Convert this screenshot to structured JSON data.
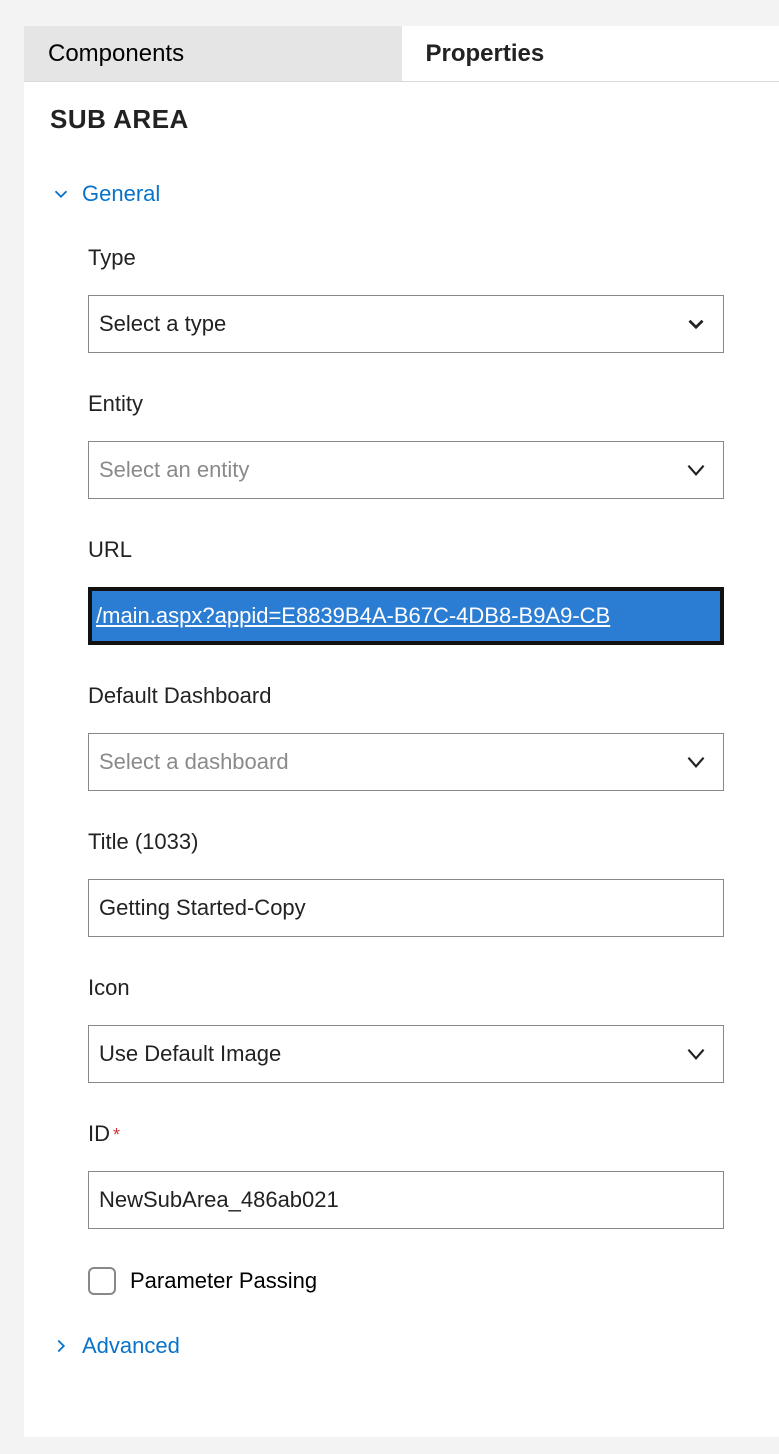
{
  "tabs": {
    "components": "Components",
    "properties": "Properties"
  },
  "section_title": "SUB AREA",
  "accordions": {
    "general": "General",
    "advanced": "Advanced"
  },
  "fields": {
    "type": {
      "label": "Type",
      "value": "Select a type"
    },
    "entity": {
      "label": "Entity",
      "placeholder": "Select an entity"
    },
    "url": {
      "label": "URL",
      "value": "/main.aspx?appid=E8839B4A-B67C-4DB8-B9A9-CB"
    },
    "default_dashboard": {
      "label": "Default Dashboard",
      "placeholder": "Select a dashboard"
    },
    "title": {
      "label": "Title (1033)",
      "value": "Getting Started-Copy"
    },
    "icon": {
      "label": "Icon",
      "value": "Use Default Image"
    },
    "id": {
      "label": "ID",
      "required": "*",
      "value": "NewSubArea_486ab021"
    },
    "parameter_passing": {
      "label": "Parameter Passing"
    }
  }
}
